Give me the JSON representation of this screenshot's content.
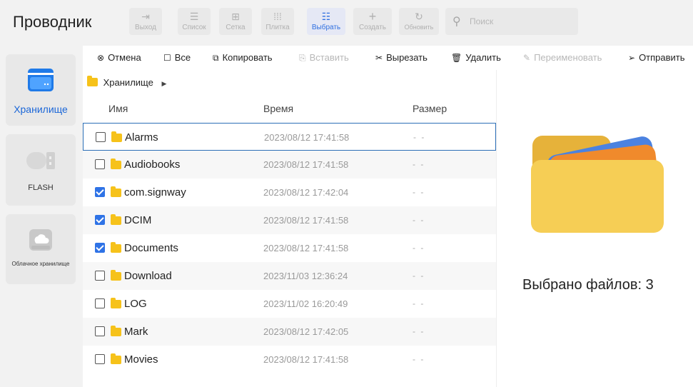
{
  "app": {
    "title": "Проводник"
  },
  "toolbar": {
    "buttons": [
      {
        "label": "Выход",
        "icon": "exit-icon",
        "state": "disabled"
      },
      {
        "label": "Список",
        "icon": "list-icon",
        "state": "disabled"
      },
      {
        "label": "Сетка",
        "icon": "grid-icon",
        "state": "disabled"
      },
      {
        "label": "Плитка",
        "icon": "tile-icon",
        "state": "disabled"
      },
      {
        "label": "Выбрать",
        "icon": "select-icon",
        "state": "active"
      },
      {
        "label": "Создать",
        "icon": "plus-icon",
        "state": "disabled"
      },
      {
        "label": "Обновить",
        "icon": "refresh-icon",
        "state": "disabled"
      }
    ],
    "search_placeholder": "Поиск"
  },
  "sidebar": {
    "items": [
      {
        "label": "Хранилище",
        "icon": "storage-icon",
        "active": true
      },
      {
        "label": "FLASH",
        "icon": "usb-flash-icon",
        "active": false
      },
      {
        "label": "Облачное хранилище",
        "icon": "cloud-drive-icon",
        "active": false
      }
    ]
  },
  "actions": [
    {
      "label": "Отмена",
      "icon": "cancel-icon",
      "enabled": true
    },
    {
      "label": "Все",
      "icon": "checkbox-icon",
      "enabled": true
    },
    {
      "label": "Копировать",
      "icon": "copy-icon",
      "enabled": true
    },
    {
      "label": "Вставить",
      "icon": "paste-icon",
      "enabled": false
    },
    {
      "label": "Вырезать",
      "icon": "scissors-icon",
      "enabled": true
    },
    {
      "label": "Удалить",
      "icon": "trash-icon",
      "enabled": true
    },
    {
      "label": "Переименовать",
      "icon": "rename-icon",
      "enabled": false
    },
    {
      "label": "Отправить",
      "icon": "send-icon",
      "enabled": true
    }
  ],
  "breadcrumb": {
    "path": "Хранилище"
  },
  "columns": {
    "name": "Имя",
    "time": "Время",
    "size": "Размер"
  },
  "files": [
    {
      "name": "Alarms",
      "time": "2023/08/12 17:41:58",
      "size": "- -",
      "checked": false
    },
    {
      "name": "Audiobooks",
      "time": "2023/08/12 17:41:58",
      "size": "- -",
      "checked": false
    },
    {
      "name": "com.signway",
      "time": "2023/08/12 17:42:04",
      "size": "- -",
      "checked": true
    },
    {
      "name": "DCIM",
      "time": "2023/08/12 17:41:58",
      "size": "- -",
      "checked": true
    },
    {
      "name": "Documents",
      "time": "2023/08/12 17:41:58",
      "size": "- -",
      "checked": true
    },
    {
      "name": "Download",
      "time": "2023/11/03 12:36:24",
      "size": "- -",
      "checked": false
    },
    {
      "name": "LOG",
      "time": "2023/11/02 16:20:49",
      "size": "- -",
      "checked": false
    },
    {
      "name": "Mark",
      "time": "2023/08/12 17:42:05",
      "size": "- -",
      "checked": false
    },
    {
      "name": "Movies",
      "time": "2023/08/12 17:41:58",
      "size": "- -",
      "checked": false
    }
  ],
  "preview": {
    "selected_text": "Выбрано файлов: 3"
  },
  "colors": {
    "accent": "#2f73e6",
    "folder": "#f6c21a",
    "focus_border": "#2c6fb7"
  }
}
